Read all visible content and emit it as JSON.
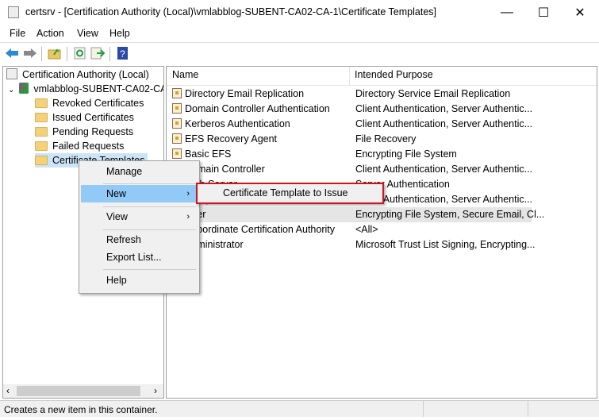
{
  "window": {
    "title": "certsrv - [Certification Authority (Local)\\vmlabblog-SUBENT-CA02-CA-1\\Certificate Templates]",
    "minimize": "—",
    "maximize": "☐",
    "close": "✕"
  },
  "menubar": [
    "File",
    "Action",
    "View",
    "Help"
  ],
  "toolbar": [
    "back-icon",
    "forward-icon",
    "up-folder-icon",
    "refresh-icon",
    "export-icon",
    "help-icon"
  ],
  "tree": {
    "root": "Certification Authority (Local)",
    "ca": "vmlabblog-SUBENT-CA02-CA",
    "items": [
      "Revoked Certificates",
      "Issued Certificates",
      "Pending Requests",
      "Failed Requests",
      "Certificate Templates"
    ]
  },
  "list": {
    "columns": [
      "Name",
      "Intended Purpose"
    ],
    "rows": [
      {
        "name": "Directory Email Replication",
        "purpose": "Directory Service Email Replication"
      },
      {
        "name": "Domain Controller Authentication",
        "purpose": "Client Authentication, Server Authentic..."
      },
      {
        "name": "Kerberos Authentication",
        "purpose": "Client Authentication, Server Authentic..."
      },
      {
        "name": "EFS Recovery Agent",
        "purpose": "File Recovery"
      },
      {
        "name": "Basic EFS",
        "purpose": "Encrypting File System"
      },
      {
        "name": "Domain Controller",
        "purpose": "Client Authentication, Server Authentic..."
      },
      {
        "name": "Web Server",
        "purpose": "Server Authentication"
      },
      {
        "name": "Computer",
        "purpose": "Client Authentication, Server Authentic..."
      },
      {
        "name": "User",
        "purpose": "Encrypting File System, Secure Email, Cl..."
      },
      {
        "name": "Subordinate Certification Authority",
        "purpose": "<All>"
      },
      {
        "name": "Administrator",
        "purpose": "Microsoft Trust List Signing, Encrypting..."
      }
    ]
  },
  "context_menu": {
    "manage": "Manage",
    "new": "New",
    "view": "View",
    "refresh": "Refresh",
    "export": "Export List...",
    "help": "Help",
    "submenu_arrow": "›"
  },
  "submenu": {
    "item": "Certificate Template to Issue"
  },
  "status": {
    "text": "Creates a new item in this container."
  }
}
